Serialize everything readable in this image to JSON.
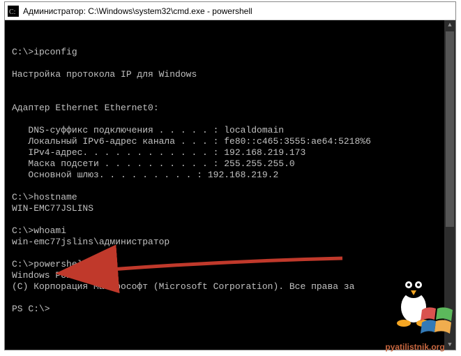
{
  "window": {
    "title": "Администратор: C:\\Windows\\system32\\cmd.exe - powershell"
  },
  "terminal": {
    "lines": [
      "C:\\>ipconfig",
      "",
      "Настройка протокола IP для Windows",
      "",
      "",
      "Адаптер Ethernet Ethernet0:",
      "",
      "   DNS-суффикс подключения . . . . . : localdomain",
      "   Локальный IPv6-адрес канала . . . : fe80::c465:3555:ae64:5218%6",
      "   IPv4-адрес. . . . . . . . . . . . : 192.168.219.173",
      "   Маска подсети . . . . . . . . . . : 255.255.255.0",
      "   Основной шлюз. . . . . . . . . : 192.168.219.2",
      "",
      "C:\\>hostname",
      "WIN-EMC77JSLINS",
      "",
      "C:\\>whoami",
      "win-emc77jslins\\администратор",
      "",
      "C:\\>powershell",
      "Windows PowerShell",
      "(C) Корпорация Майкрософт (Microsoft Corporation). Все права за",
      "",
      "PS C:\\>"
    ]
  },
  "watermark": {
    "text": "pyatilistnik.org"
  },
  "icons": {
    "cmd": "cmd-icon"
  }
}
